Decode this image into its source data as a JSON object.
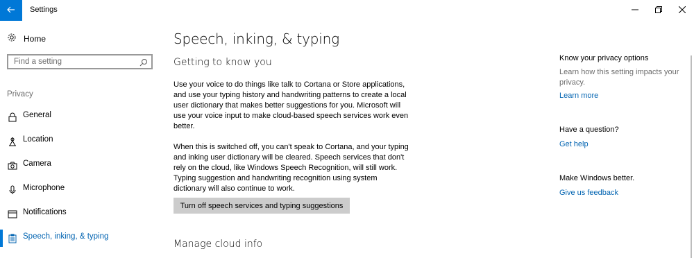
{
  "window": {
    "title": "Settings"
  },
  "sidebar": {
    "home_label": "Home",
    "search_placeholder": "Find a setting",
    "section_label": "Privacy",
    "items": [
      {
        "label": "General",
        "icon": "lock-icon"
      },
      {
        "label": "Location",
        "icon": "location-icon"
      },
      {
        "label": "Camera",
        "icon": "camera-icon"
      },
      {
        "label": "Microphone",
        "icon": "microphone-icon"
      },
      {
        "label": "Notifications",
        "icon": "notifications-icon"
      },
      {
        "label": "Speech, inking, & typing",
        "icon": "clipboard-icon",
        "active": true
      }
    ]
  },
  "main": {
    "title": "Speech, inking, & typing",
    "subtitle": "Getting to know you",
    "paragraph1": "Use your voice to do things like talk to Cortana or Store applications, and use your typing history and handwriting patterns to create a local user dictionary that makes better suggestions for you. Microsoft will use your voice input to make cloud-based speech services work even better.",
    "paragraph2": "When this is switched off, you can't speak to Cortana, and your typing and inking user dictionary will be cleared. Speech services that don't rely on the cloud, like Windows Speech Recognition, will still work. Typing suggestion and handwriting recognition using system dictionary will also continue to work.",
    "button_label": "Turn off speech services and typing suggestions",
    "manage_title": "Manage cloud info"
  },
  "right": {
    "privacy_heading": "Know your privacy options",
    "privacy_desc": "Learn how this setting impacts your privacy.",
    "learn_more": "Learn more",
    "question_heading": "Have a question?",
    "get_help": "Get help",
    "better_heading": "Make Windows better.",
    "feedback": "Give us feedback"
  },
  "colors": {
    "accent": "#0078d7",
    "link": "#0063b1",
    "button_bg": "#cccccc",
    "muted_text": "#6d6d6d"
  }
}
